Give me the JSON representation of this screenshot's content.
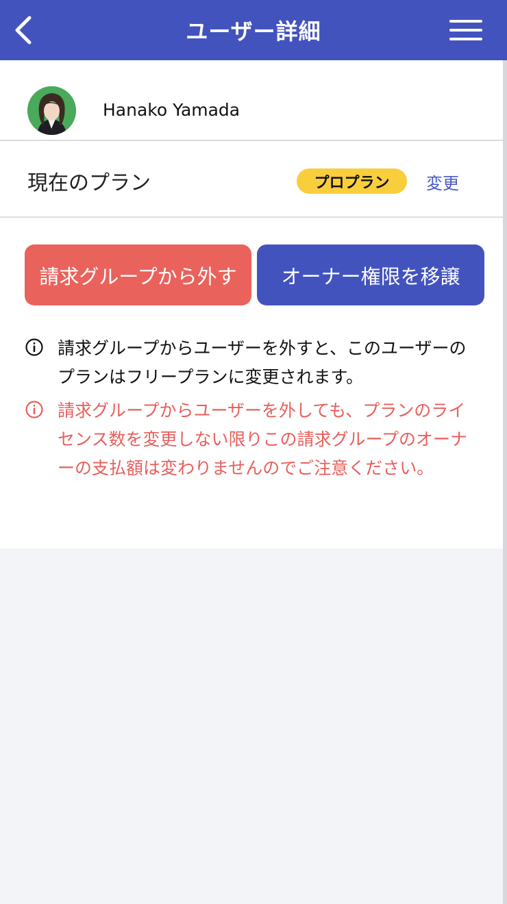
{
  "header": {
    "title": "ユーザー詳細",
    "back_icon": "chevron-left-icon",
    "menu_icon": "hamburger-menu-icon"
  },
  "user": {
    "name": "Hanako Yamada"
  },
  "plan": {
    "label": "現在のプラン",
    "badge": "プロプラン",
    "change_link": "変更"
  },
  "actions": {
    "remove_label": "請求グループから外す",
    "transfer_label": "オーナー権限を移譲"
  },
  "notes": [
    {
      "text": "請求グループからユーザーを外すと、このユーザーのプランはフリープランに変更されます。",
      "icon": "info-icon"
    },
    {
      "text": "請求グループからユーザーを外しても、プランのライセンス数を変更しない限りこの請求グループのオーナーの支払額は変わりませんのでご注意ください。",
      "icon": "info-icon"
    }
  ],
  "colors": {
    "header_bg": "#4353be",
    "danger": "#ea625c",
    "primary": "#4353be",
    "badge": "#f8ce3c",
    "link": "#4a5ac8"
  }
}
